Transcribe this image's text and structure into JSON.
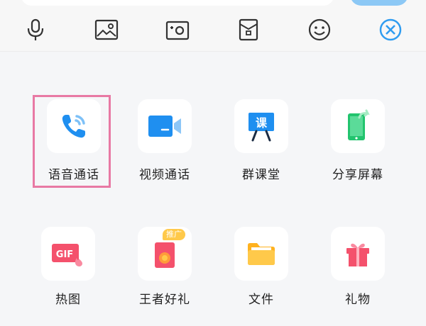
{
  "toolbar": {
    "tools": [
      {
        "icon": "microphone-icon"
      },
      {
        "icon": "image-icon"
      },
      {
        "icon": "camera-icon"
      },
      {
        "icon": "red-packet-icon"
      },
      {
        "icon": "emoji-icon"
      },
      {
        "icon": "close-icon"
      }
    ],
    "accent_color": "#2f9cf0"
  },
  "panel": {
    "items": [
      {
        "label": "语音通话",
        "icon": "phone-icon",
        "selected": true
      },
      {
        "label": "视频通话",
        "icon": "video-camera-icon"
      },
      {
        "label": "群课堂",
        "icon": "classroom-icon",
        "glyph": "课"
      },
      {
        "label": "分享屏幕",
        "icon": "share-screen-icon"
      },
      {
        "label": "热图",
        "icon": "gif-icon",
        "glyph": "GIF"
      },
      {
        "label": "王者好礼",
        "icon": "game-gift-icon",
        "badge": "推广"
      },
      {
        "label": "文件",
        "icon": "folder-icon"
      },
      {
        "label": "礼物",
        "icon": "gift-icon"
      }
    ],
    "highlight_color": "#e879a4"
  }
}
